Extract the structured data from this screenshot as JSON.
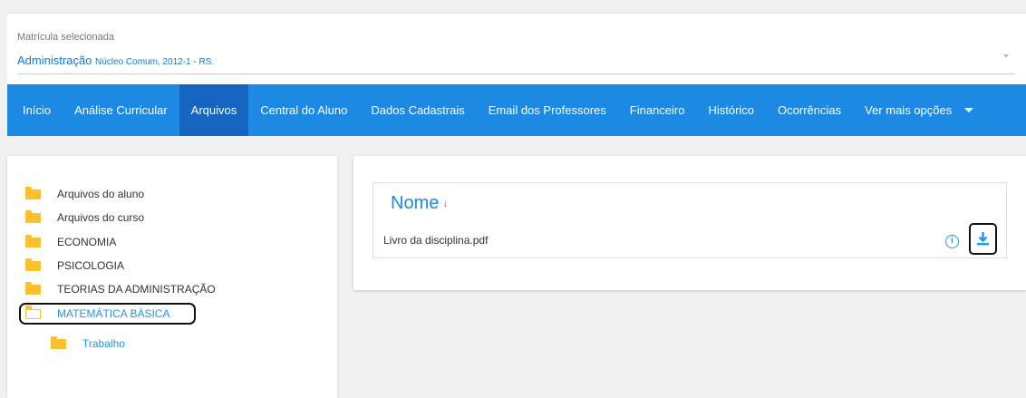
{
  "selector": {
    "label": "Matrícula selecionada",
    "value": "Administração",
    "detail": "Núcleo Comum, 2012-1 - RS."
  },
  "nav": {
    "items": [
      {
        "label": "Início"
      },
      {
        "label": "Análise Curricular"
      },
      {
        "label": "Arquivos"
      },
      {
        "label": "Central do Aluno"
      },
      {
        "label": "Dados Cadastrais"
      },
      {
        "label": "Email dos Professores"
      },
      {
        "label": "Financeiro"
      },
      {
        "label": "Histórico"
      },
      {
        "label": "Ocorrências"
      },
      {
        "label": "Ver mais opções"
      }
    ],
    "active": "Arquivos"
  },
  "folders": [
    {
      "label": "Arquivos do aluno"
    },
    {
      "label": "Arquivos do curso"
    },
    {
      "label": "ECONOMIA"
    },
    {
      "label": "PSICOLOGIA"
    },
    {
      "label": "TEORIAS DA ADMINISTRAÇÃO"
    },
    {
      "label": "MATEMÁTICA BÁSICA"
    },
    {
      "label": "Trabalho"
    }
  ],
  "files": {
    "column_header": "Nome",
    "sort_arrow": "↓",
    "rows": [
      {
        "name": "Livro da disciplina.pdf"
      }
    ]
  },
  "icons": {
    "folder_color": "#fbc02d",
    "accent": "#1e88e5",
    "active_nav": "#1565c0",
    "info": "info-icon",
    "download": "download-icon"
  }
}
